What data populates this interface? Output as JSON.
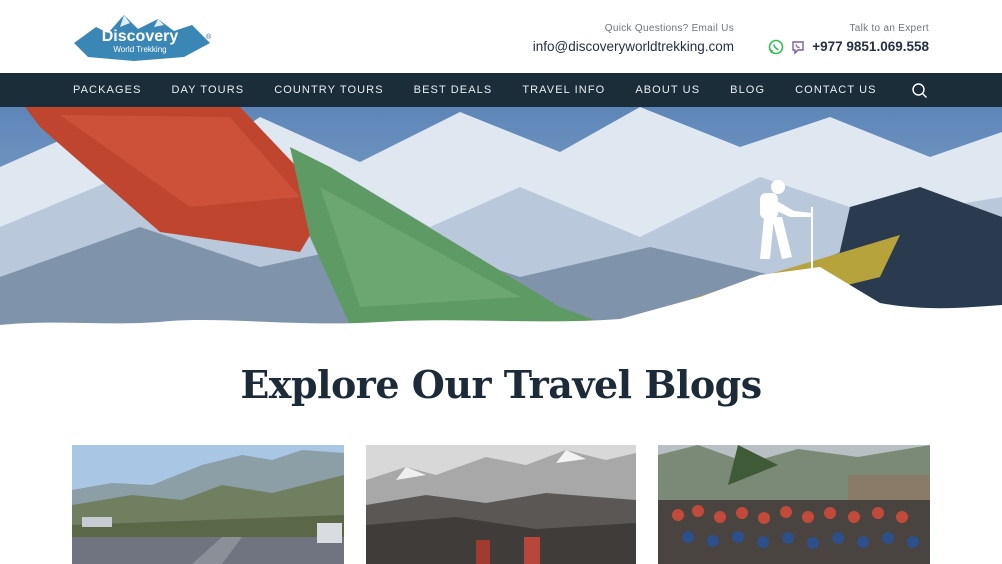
{
  "header": {
    "logo": {
      "line1": "Discovery",
      "line2": "World Trekking",
      "mark": "®"
    },
    "email": {
      "caption": "Quick Questions? Email Us",
      "value": "info@discoveryworldtrekking.com"
    },
    "phone": {
      "caption": "Talk to an Expert",
      "value": "+977 9851.069.558",
      "icons": [
        "whatsapp-icon",
        "viber-icon"
      ]
    }
  },
  "nav": {
    "items": [
      "PACKAGES",
      "DAY TOURS",
      "COUNTRY TOURS",
      "BEST DEALS",
      "TRAVEL INFO",
      "ABOUT US",
      "BLOG",
      "CONTACT US"
    ],
    "search_icon": "search-icon"
  },
  "blogs": {
    "title": "Explore Our Travel Blogs"
  },
  "colors": {
    "nav_bg": "#1c2d3a",
    "logo_blue": "#3a86b4",
    "whatsapp": "#2fbf4f",
    "viber": "#7b5ea7"
  }
}
